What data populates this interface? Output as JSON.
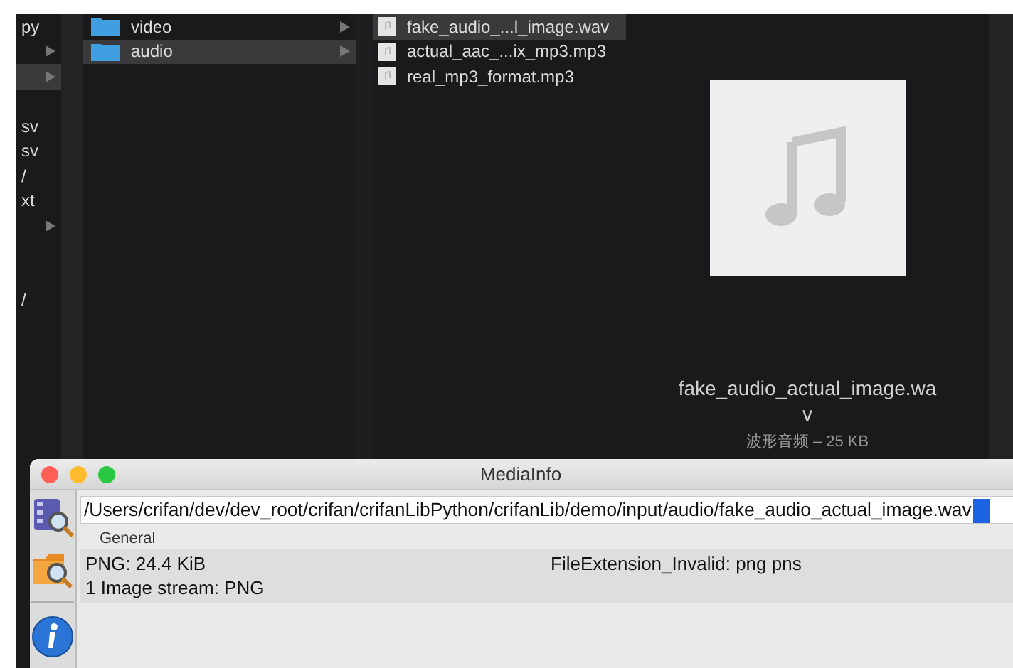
{
  "finder": {
    "column_1": [
      {
        "label": "py",
        "arrow": false,
        "selected": false
      },
      {
        "arrow": true,
        "selected": false
      },
      {
        "arrow": true,
        "selected": true
      },
      {
        "arrow": false,
        "selected": false
      },
      {
        "label": "sv",
        "arrow": false,
        "selected": false
      },
      {
        "label": "sv",
        "arrow": false,
        "selected": false
      },
      {
        "label": "/",
        "arrow": false,
        "selected": false
      },
      {
        "label": "xt",
        "arrow": false,
        "selected": false
      },
      {
        "arrow": true,
        "selected": false
      },
      {
        "arrow": false,
        "selected": false
      },
      {
        "arrow": false,
        "selected": false
      },
      {
        "label": "/",
        "arrow": false,
        "selected": false
      }
    ],
    "folders": [
      {
        "name": "video",
        "selected": false
      },
      {
        "name": "audio",
        "selected": true
      }
    ],
    "files": [
      {
        "name": "fake_audio_...l_image.wav",
        "selected": true
      },
      {
        "name": "actual_aac_...ix_mp3.mp3",
        "selected": false
      },
      {
        "name": "real_mp3_format.mp3",
        "selected": false
      }
    ],
    "preview": {
      "name_lines": [
        "fake_audio_actual_image.wa",
        "v"
      ],
      "info": "波形音频 – 25 KB"
    }
  },
  "mediainfo": {
    "title": "MediaInfo",
    "path": "/Users/crifan/dev/dev_root/crifan/crifanLibPython/crifanLib/demo/input/audio/fake_audio_actual_image.wav",
    "tab": "General",
    "info_rows": [
      [
        "PNG: 24.4 KiB",
        "FileExtension_Invalid: png pns"
      ],
      [
        "1 Image stream: PNG"
      ]
    ]
  }
}
